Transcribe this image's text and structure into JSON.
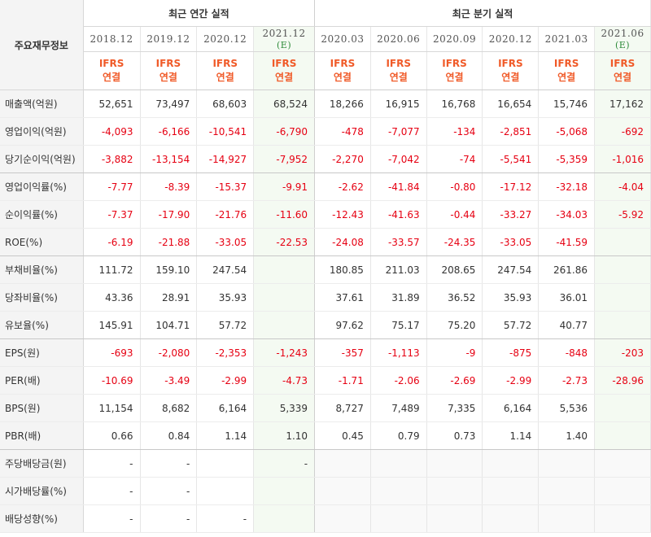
{
  "header": {
    "corner_label": "주요재무정보",
    "annual_group_label": "최근 연간 실적",
    "quarter_group_label": "최근 분기 실적",
    "annual_periods": [
      {
        "label": "2018.12",
        "est": ""
      },
      {
        "label": "2019.12",
        "est": ""
      },
      {
        "label": "2020.12",
        "est": ""
      },
      {
        "label": "2021.12",
        "est": "(E)"
      }
    ],
    "quarter_periods": [
      {
        "label": "2020.03",
        "est": ""
      },
      {
        "label": "2020.06",
        "est": ""
      },
      {
        "label": "2020.09",
        "est": ""
      },
      {
        "label": "2020.12",
        "est": ""
      },
      {
        "label": "2021.03",
        "est": ""
      },
      {
        "label": "2021.06",
        "est": "(E)"
      }
    ],
    "basis_line1": "IFRS",
    "basis_line2": "연결"
  },
  "colors": {
    "negative": "#e60012",
    "basis": "#f05a28",
    "estimate_bg": "#f4faf2"
  },
  "rows": [
    {
      "label": "매출액(억원)",
      "values": [
        "52,651",
        "73,497",
        "68,603",
        "68,524",
        "18,266",
        "16,915",
        "16,768",
        "16,654",
        "15,746",
        "17,162"
      ]
    },
    {
      "label": "영업이익(억원)",
      "values": [
        "-4,093",
        "-6,166",
        "-10,541",
        "-6,790",
        "-478",
        "-7,077",
        "-134",
        "-2,851",
        "-5,068",
        "-692"
      ]
    },
    {
      "label": "당기순이익(억원)",
      "values": [
        "-3,882",
        "-13,154",
        "-14,927",
        "-7,952",
        "-2,270",
        "-7,042",
        "-74",
        "-5,541",
        "-5,359",
        "-1,016"
      ]
    },
    {
      "label": "영업이익률(%)",
      "values": [
        "-7.77",
        "-8.39",
        "-15.37",
        "-9.91",
        "-2.62",
        "-41.84",
        "-0.80",
        "-17.12",
        "-32.18",
        "-4.04"
      ]
    },
    {
      "label": "순이익률(%)",
      "values": [
        "-7.37",
        "-17.90",
        "-21.76",
        "-11.60",
        "-12.43",
        "-41.63",
        "-0.44",
        "-33.27",
        "-34.03",
        "-5.92"
      ]
    },
    {
      "label": "ROE(%)",
      "values": [
        "-6.19",
        "-21.88",
        "-33.05",
        "-22.53",
        "-24.08",
        "-33.57",
        "-24.35",
        "-33.05",
        "-41.59",
        ""
      ]
    },
    {
      "label": "부채비율(%)",
      "values": [
        "111.72",
        "159.10",
        "247.54",
        "",
        "180.85",
        "211.03",
        "208.65",
        "247.54",
        "261.86",
        ""
      ]
    },
    {
      "label": "당좌비율(%)",
      "values": [
        "43.36",
        "28.91",
        "35.93",
        "",
        "37.61",
        "31.89",
        "36.52",
        "35.93",
        "36.01",
        ""
      ]
    },
    {
      "label": "유보율(%)",
      "values": [
        "145.91",
        "104.71",
        "57.72",
        "",
        "97.62",
        "75.17",
        "75.20",
        "57.72",
        "40.77",
        ""
      ]
    },
    {
      "label": "EPS(원)",
      "values": [
        "-693",
        "-2,080",
        "-2,353",
        "-1,243",
        "-357",
        "-1,113",
        "-9",
        "-875",
        "-848",
        "-203"
      ]
    },
    {
      "label": "PER(배)",
      "values": [
        "-10.69",
        "-3.49",
        "-2.99",
        "-4.73",
        "-1.71",
        "-2.06",
        "-2.69",
        "-2.99",
        "-2.73",
        "-28.96"
      ]
    },
    {
      "label": "BPS(원)",
      "values": [
        "11,154",
        "8,682",
        "6,164",
        "5,339",
        "8,727",
        "7,489",
        "7,335",
        "6,164",
        "5,536",
        ""
      ]
    },
    {
      "label": "PBR(배)",
      "values": [
        "0.66",
        "0.84",
        "1.14",
        "1.10",
        "0.45",
        "0.79",
        "0.73",
        "1.14",
        "1.40",
        ""
      ]
    },
    {
      "label": "주당배당금(원)",
      "values": [
        "-",
        "-",
        "",
        "-",
        "",
        "",
        "",
        "",
        "",
        ""
      ]
    },
    {
      "label": "시가배당률(%)",
      "values": [
        "-",
        "-",
        "",
        "",
        "",
        "",
        "",
        "",
        "",
        ""
      ]
    },
    {
      "label": "배당성향(%)",
      "values": [
        "-",
        "-",
        "-",
        "",
        "",
        "",
        "",
        "",
        "",
        ""
      ]
    }
  ]
}
